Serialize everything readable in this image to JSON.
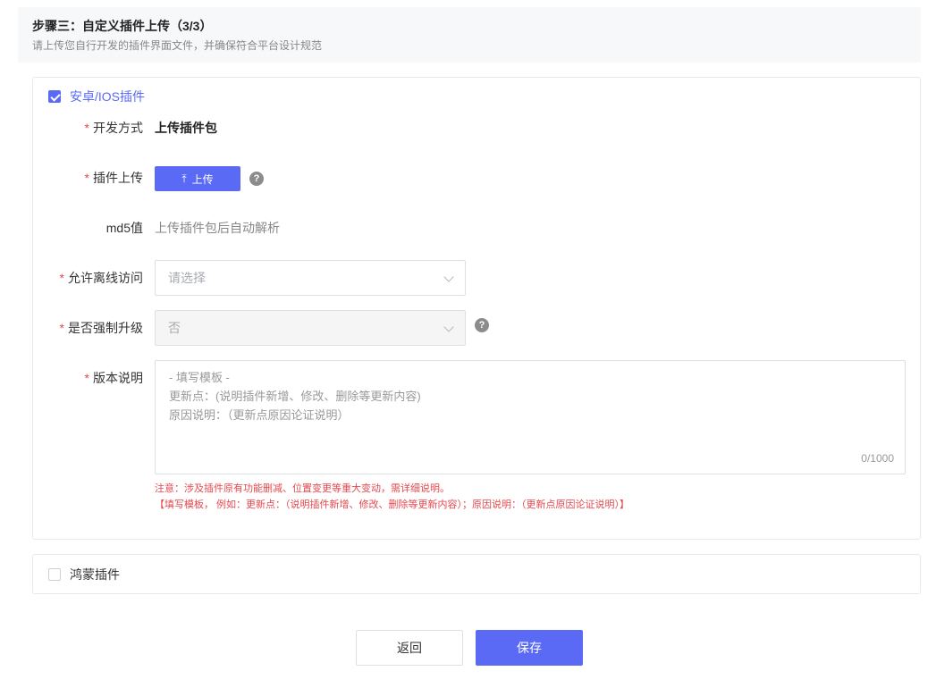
{
  "step": {
    "title": "步骤三：自定义插件上传（3/3）",
    "description": "请上传您自行开发的插件界面文件，并确保符合平台设计规范"
  },
  "android_ios": {
    "label": "安卓/IOS插件",
    "checked": true,
    "dev_method": {
      "required_mark": "*",
      "label": "开发方式",
      "value": "上传插件包"
    },
    "plugin_upload": {
      "required_mark": "*",
      "label": "插件上传",
      "button_label": "上传",
      "button_icon": "upload-arrow-icon",
      "help_icon": "question-circle-icon"
    },
    "md5": {
      "label": "md5值",
      "value": "上传插件包后自动解析"
    },
    "offline_access": {
      "required_mark": "*",
      "label": "允许离线访问",
      "placeholder": "请选择"
    },
    "force_upgrade": {
      "required_mark": "*",
      "label": "是否强制升级",
      "value": "否",
      "disabled": true,
      "help_icon": "question-circle-icon"
    },
    "version_notes": {
      "required_mark": "*",
      "label": "版本说明",
      "placeholder": "- 填写模板 -\n更新点：(说明插件新增、修改、删除等更新内容)\n原因说明：（更新点原因论证说明）",
      "counter": "0/1000",
      "notice_line1": "注意：涉及插件原有功能删减、位置变更等重大变动，需详细说明。",
      "notice_line2": "【填写模板， 例如：更新点：（说明插件新增、修改、删除等更新内容）；原因说明：（更新点原因论证说明）】"
    }
  },
  "harmony": {
    "label": "鸿蒙插件",
    "checked": false
  },
  "footer": {
    "back_label": "返回",
    "save_label": "保存"
  },
  "colors": {
    "primary": "#5b6af5",
    "required": "#e5484d",
    "border": "#dcdfe6"
  }
}
